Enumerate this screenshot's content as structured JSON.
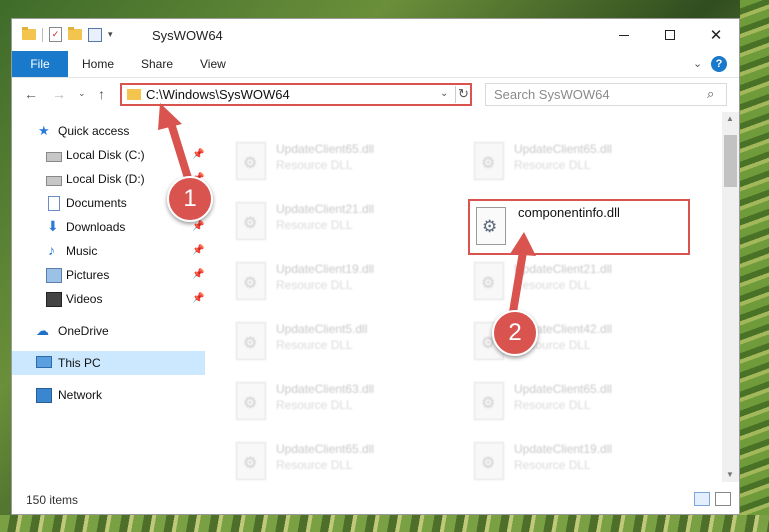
{
  "window": {
    "title": "SysWOW64"
  },
  "ribbon": {
    "tabs": [
      "File",
      "Home",
      "Share",
      "View"
    ],
    "help_label": "?"
  },
  "address": {
    "path": "C:\\Windows\\SysWOW64"
  },
  "search": {
    "placeholder": "Search SysWOW64"
  },
  "navpane": {
    "items": [
      {
        "label": "Quick access",
        "icon": "star-icon",
        "pinned": false
      },
      {
        "label": "Local Disk (C:)",
        "icon": "drive-icon",
        "pinned": true
      },
      {
        "label": "Local Disk (D:)",
        "icon": "drive-icon",
        "pinned": true
      },
      {
        "label": "Documents",
        "icon": "documents-icon",
        "pinned": true
      },
      {
        "label": "Downloads",
        "icon": "download-icon",
        "pinned": true
      },
      {
        "label": "Music",
        "icon": "music-icon",
        "pinned": true
      },
      {
        "label": "Pictures",
        "icon": "pictures-icon",
        "pinned": true
      },
      {
        "label": "Videos",
        "icon": "videos-icon",
        "pinned": true
      },
      {
        "label": "OneDrive",
        "icon": "cloud-icon",
        "pinned": false
      },
      {
        "label": "This PC",
        "icon": "computer-icon",
        "pinned": false,
        "selected": true
      },
      {
        "label": "Network",
        "icon": "network-icon",
        "pinned": false
      }
    ]
  },
  "files": {
    "left_column": [
      {
        "name": "UpdateClient65.dll",
        "type": "Resource DLL"
      },
      {
        "name": "UpdateClient21.dll",
        "type": "Resource DLL"
      },
      {
        "name": "UpdateClient19.dll",
        "type": "Resource DLL"
      },
      {
        "name": "UpdateClient5.dll",
        "type": "Resource DLL"
      },
      {
        "name": "UpdateClient63.dll",
        "type": "Resource DLL"
      },
      {
        "name": "UpdateClient65.dll",
        "type": "Resource DLL"
      }
    ],
    "right_column": [
      {
        "name": "UpdateClient65.dll",
        "type": "Resource DLL"
      },
      {
        "name": "componentinfo.dll",
        "type": "",
        "highlighted": true
      },
      {
        "name": "UpdateClient21.dll",
        "type": "Resource DLL"
      },
      {
        "name": "UpdateClient42.dll",
        "type": "Resource DLL"
      },
      {
        "name": "UpdateClient65.dll",
        "type": "Resource DLL"
      },
      {
        "name": "UpdateClient19.dll",
        "type": "Resource DLL"
      }
    ]
  },
  "status": {
    "item_count": "150 items"
  },
  "annotations": {
    "marker1": "1",
    "marker2": "2",
    "color": "#d9534f"
  },
  "colors": {
    "accent": "#1979ca",
    "selection": "#cce8ff"
  }
}
